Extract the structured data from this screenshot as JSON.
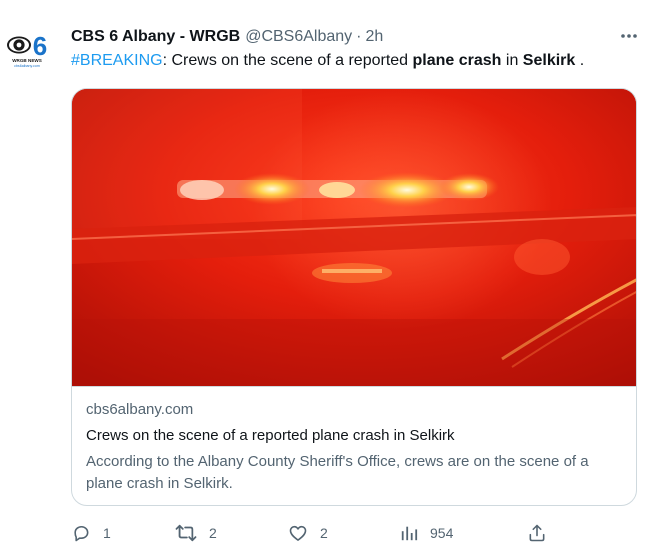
{
  "colors": {
    "accent": "#1d9bf0",
    "text_primary": "#0f1419",
    "text_secondary": "#536471",
    "border": "#cfd9de"
  },
  "tweet": {
    "author_name": "CBS 6 Albany - WRGB",
    "author_handle": "@CBS6Albany",
    "separator": "·",
    "time": "2h",
    "avatar": {
      "icon": "cbs-eye-logo",
      "number": "6",
      "line1": "WRGB NEWS",
      "line2": "cbs6albany.com"
    },
    "more_icon": "more-horizontal-icon",
    "text": {
      "hashtag": "#BREAKING",
      "part1": ": Crews on the scene of a reported ",
      "bold1": "plane crash",
      "part2": " in ",
      "bold2": "Selkirk",
      "part3": " ."
    }
  },
  "card": {
    "image_description_icon": "emergency-lights-photo",
    "domain": "cbs6albany.com",
    "title": "Crews on the scene of a reported plane crash in Selkirk",
    "description": "According to the Albany County Sheriff's Office, crews are on the scene of a plane crash in Selkirk."
  },
  "actions": {
    "reply": {
      "icon": "reply-icon",
      "count": "1"
    },
    "retweet": {
      "icon": "retweet-icon",
      "count": "2"
    },
    "like": {
      "icon": "heart-icon",
      "count": "2"
    },
    "views": {
      "icon": "views-icon",
      "count": "954"
    },
    "share": {
      "icon": "share-icon"
    }
  }
}
